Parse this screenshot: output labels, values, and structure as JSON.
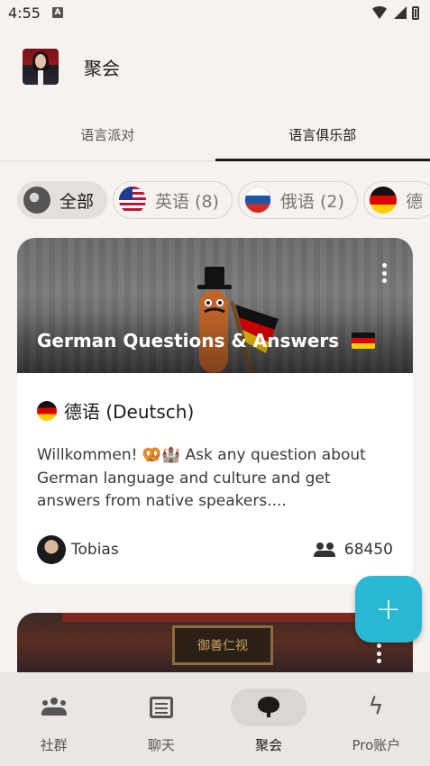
{
  "status_bar": {
    "time": "4:55",
    "notification_letter": "A"
  },
  "header": {
    "title": "聚会"
  },
  "tabs": [
    {
      "label": "语言派对",
      "active": false
    },
    {
      "label": "语言俱乐部",
      "active": true
    }
  ],
  "filter_chips": [
    {
      "label": "全部",
      "icon": "globe-icon",
      "active": true
    },
    {
      "label": "英语 (8)",
      "icon": "us-flag-icon",
      "active": false
    },
    {
      "label": "俄语 (2)",
      "icon": "russia-flag-icon",
      "active": false
    },
    {
      "label": "德",
      "icon": "germany-flag-icon",
      "active": false
    }
  ],
  "club_card": {
    "title": "German Questions & Answers",
    "language": "德语 (Deutsch)",
    "description": "Willkommen! 🥨🏰 Ask any question about German language and culture and get answers from native speakers....",
    "owner": "Tobias",
    "member_count": "68450"
  },
  "second_card": {
    "sign_text": "御善仁视"
  },
  "fab": {
    "label": "+"
  },
  "bottom_nav": [
    {
      "label": "社群",
      "icon": "group-icon",
      "active": false
    },
    {
      "label": "聊天",
      "icon": "chat-icon",
      "active": false
    },
    {
      "label": "聚会",
      "icon": "balloon-icon",
      "active": true
    },
    {
      "label": "Pro账户",
      "icon": "bolt-icon",
      "active": false
    }
  ],
  "colors": {
    "accent": "#29b7d3",
    "background": "#f6f2ef",
    "nav_background": "#ebe6e3"
  }
}
